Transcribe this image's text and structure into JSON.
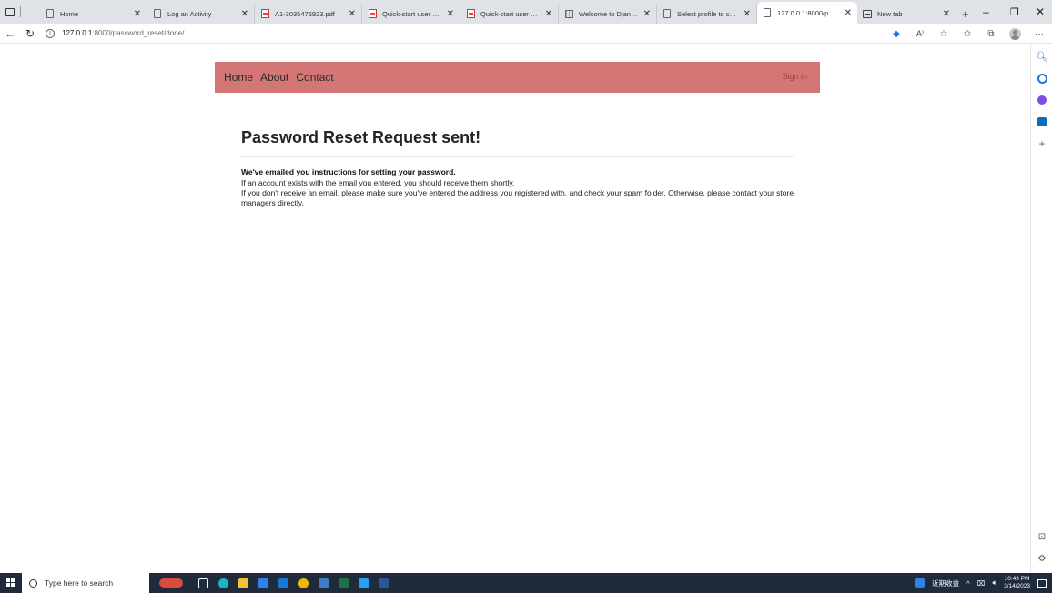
{
  "browser": {
    "tabs": [
      {
        "title": "Home",
        "favicon": "document-icon",
        "active": false
      },
      {
        "title": "Log an Activity",
        "favicon": "document-icon",
        "active": false
      },
      {
        "title": "A1-3035476923.pdf",
        "favicon": "pdf-icon",
        "active": false
      },
      {
        "title": "Quick-start user guide",
        "favicon": "pdf-icon",
        "active": false
      },
      {
        "title": "Quick-start user guide",
        "favicon": "pdf-icon",
        "active": false
      },
      {
        "title": "Welcome to Django C",
        "favicon": "grid-icon",
        "active": false
      },
      {
        "title": "Select profile to chang",
        "favicon": "document-icon",
        "active": false
      },
      {
        "title": "127.0.0.1:8000/passwo",
        "favicon": "document-icon",
        "active": true
      },
      {
        "title": "New tab",
        "favicon": "newtab-icon",
        "active": false
      }
    ],
    "url_host": "127.0.0.1",
    "url_path": ":8000/password_reset/done/"
  },
  "navbar": {
    "links": [
      "Home",
      "About",
      "Contact"
    ],
    "sign_in": "Sign in",
    "color": "#d47576"
  },
  "page": {
    "heading": "Password Reset Request sent!",
    "bold_line": "We've emailed you instructions for setting your password.",
    "line1": "If an account exists with the email you entered, you should receive them shortly.",
    "line2": "If you don't receive an email, please make sure you've entered the address you registered with, and check your spam folder. Otherwise, please contact your store managers directly."
  },
  "taskbar": {
    "search_placeholder": "Type here to search",
    "tray_label": "近期收益",
    "time": "10:49 PM",
    "date": "3/14/2023"
  }
}
